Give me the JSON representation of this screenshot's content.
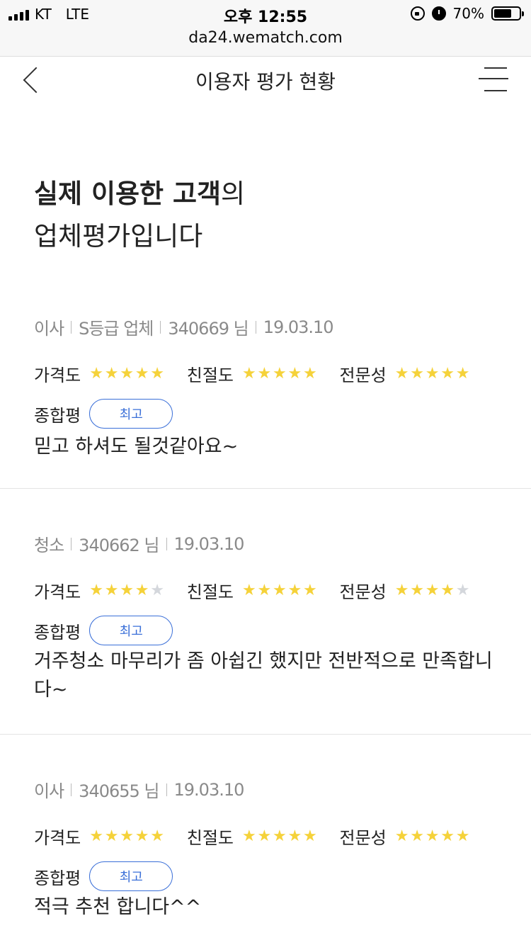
{
  "status_bar": {
    "carrier": "KT",
    "network": "LTE",
    "time": "오후 12:55",
    "battery": "70%",
    "battery_level": 0.7,
    "icons": [
      "signal-icon",
      "lock-rotation-icon",
      "alarm-icon",
      "battery-icon"
    ]
  },
  "browser": {
    "url": "da24.wematch.com"
  },
  "header": {
    "title": "이용자 평가 현황",
    "back_icon": "chevron-left-icon",
    "menu_icon": "hamburger-menu-icon"
  },
  "intro": {
    "bold": "실제 이용한 고객",
    "suffix": "의",
    "line2": "업체평가입니다"
  },
  "colors": {
    "star_on": "#f5d23a",
    "star_off": "#d4d7dc",
    "badge_accent": "#3a6fd8"
  },
  "reviews": [
    {
      "meta": [
        "이사",
        "S등급 업체",
        "340669 님",
        "19.03.10"
      ],
      "ratings": [
        {
          "label": "가격도",
          "stars": 5,
          "max": 5
        },
        {
          "label": "친절도",
          "stars": 5,
          "max": 5
        },
        {
          "label": "전문성",
          "stars": 5,
          "max": 5
        }
      ],
      "overall_label": "종합평",
      "overall": "최고",
      "comment": "믿고 하셔도 될것같아요~"
    },
    {
      "meta": [
        "청소",
        "340662 님",
        "19.03.10"
      ],
      "ratings": [
        {
          "label": "가격도",
          "stars": 4,
          "max": 5
        },
        {
          "label": "친절도",
          "stars": 5,
          "max": 5
        },
        {
          "label": "전문성",
          "stars": 4,
          "max": 5
        }
      ],
      "overall_label": "종합평",
      "overall": "최고",
      "comment": "거주청소 마무리가 좀 아쉽긴 했지만 전반적으로 만족합니다~"
    },
    {
      "meta": [
        "이사",
        "340655 님",
        "19.03.10"
      ],
      "ratings": [
        {
          "label": "가격도",
          "stars": 5,
          "max": 5
        },
        {
          "label": "친절도",
          "stars": 5,
          "max": 5
        },
        {
          "label": "전문성",
          "stars": 5,
          "max": 5
        }
      ],
      "overall_label": "종합평",
      "overall": "최고",
      "comment": "적극 추천 합니다^^"
    }
  ]
}
